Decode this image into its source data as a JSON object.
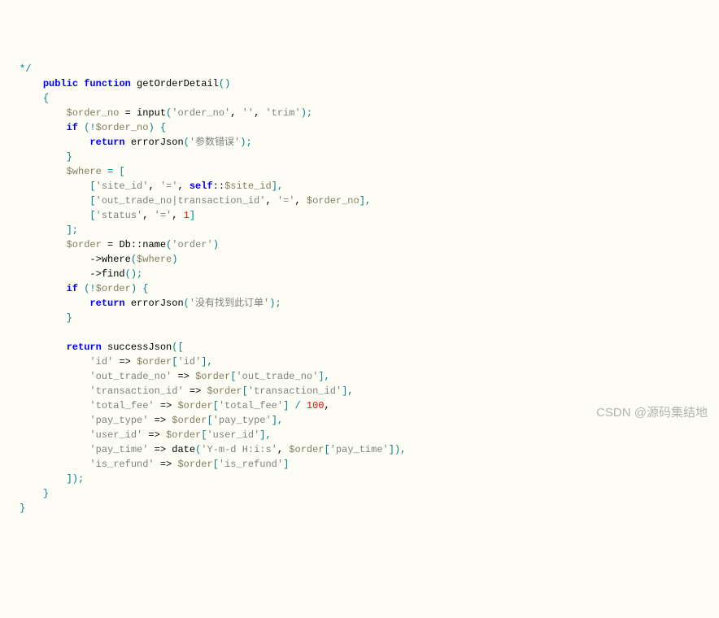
{
  "code": {
    "l1_kw1": "public",
    "l1_kw2": "function",
    "l1_fn": "getOrderDetail",
    "l1_par": "()",
    "l2_br": "{",
    "l3_var": "$order_no",
    "l3_eq": " = ",
    "l3_call": "input",
    "l3_open": "(",
    "l3_s1": "'order_no'",
    "l3_c1": ", ",
    "l3_s2": "''",
    "l3_c2": ", ",
    "l3_s3": "'trim'",
    "l3_close": ");",
    "l4_kw": "if",
    "l4_open": " (!",
    "l4_var": "$order_no",
    "l4_close": ") {",
    "l5_kw": "return",
    "l5_call": " errorJson",
    "l5_open": "(",
    "l5_str": "'参数错误'",
    "l5_close": ");",
    "l6_br": "}",
    "l7_var": "$where",
    "l7_eq": " = [",
    "l8_open": "[",
    "l8_s1": "'site_id'",
    "l8_c1": ", ",
    "l8_s2": "'='",
    "l8_c2": ", ",
    "l8_self": "self",
    "l8_sc": "::",
    "l8_sv": "$site_id",
    "l8_close": "],",
    "l9_open": "[",
    "l9_s1": "'out_trade_no|transaction_id'",
    "l9_c1": ", ",
    "l9_s2": "'='",
    "l9_c2": ", ",
    "l9_var": "$order_no",
    "l9_close": "],",
    "l10_open": "[",
    "l10_s1": "'status'",
    "l10_c1": ", ",
    "l10_s2": "'='",
    "l10_c2": ", ",
    "l10_num": "1",
    "l10_close": "]",
    "l11_br": "];",
    "l12_var": "$order",
    "l12_eq": " = ",
    "l12_db": "Db",
    "l12_sc": "::",
    "l12_name": "name",
    "l12_open": "(",
    "l12_s1": "'order'",
    "l12_close": ")",
    "l13_arrow": "->",
    "l13_call": "where",
    "l13_open": "(",
    "l13_var": "$where",
    "l13_close": ")",
    "l14_arrow": "->",
    "l14_call": "find",
    "l14_par": "();",
    "l15_kw": "if",
    "l15_open": " (!",
    "l15_var": "$order",
    "l15_close": ") {",
    "l16_kw": "return",
    "l16_call": " errorJson",
    "l16_open": "(",
    "l16_str": "'没有找到此订单'",
    "l16_close": ");",
    "l17_br": "}",
    "l19_kw": "return",
    "l19_call": " successJson",
    "l19_open": "([",
    "l20_k": "'id'",
    "l20_ar": " => ",
    "l20_var": "$order",
    "l20_idx": "[",
    "l20_ks": "'id'",
    "l20_close": "],",
    "l21_k": "'out_trade_no'",
    "l21_ar": " => ",
    "l21_var": "$order",
    "l21_idx": "[",
    "l21_ks": "'out_trade_no'",
    "l21_close": "],",
    "l22_k": "'transaction_id'",
    "l22_ar": " => ",
    "l22_var": "$order",
    "l22_idx": "[",
    "l22_ks": "'transaction_id'",
    "l22_close": "],",
    "l23_k": "'total_fee'",
    "l23_ar": " => ",
    "l23_var": "$order",
    "l23_idx": "[",
    "l23_ks": "'total_fee'",
    "l23_b": "] / ",
    "l23_num": "100",
    "l23_close": ",",
    "l24_k": "'pay_type'",
    "l24_ar": " => ",
    "l24_var": "$order",
    "l24_idx": "[",
    "l24_ks": "'pay_type'",
    "l24_close": "],",
    "l25_k": "'user_id'",
    "l25_ar": " => ",
    "l25_var": "$order",
    "l25_idx": "[",
    "l25_ks": "'user_id'",
    "l25_close": "],",
    "l26_k": "'pay_time'",
    "l26_ar": " => ",
    "l26_call": "date",
    "l26_open": "(",
    "l26_s1": "'Y-m-d H:i:s'",
    "l26_c1": ", ",
    "l26_var": "$order",
    "l26_idx": "[",
    "l26_ks": "'pay_time'",
    "l26_close": "]),",
    "l27_k": "'is_refund'",
    "l27_ar": " => ",
    "l27_var": "$order",
    "l27_idx": "[",
    "l27_ks": "'is_refund'",
    "l27_close": "]",
    "l28_br": "]);",
    "l29_br": "}",
    "l30_br": "}"
  },
  "watermark": "CSDN @源码集结地"
}
